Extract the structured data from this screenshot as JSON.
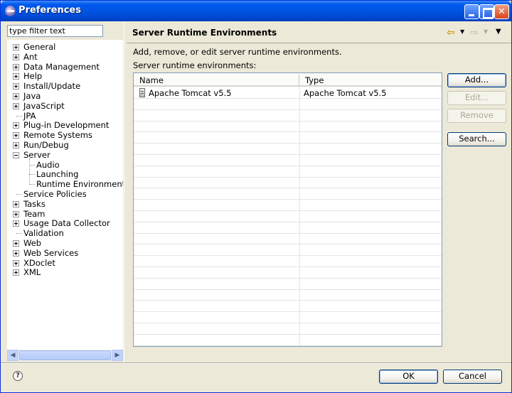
{
  "window": {
    "title": "Preferences"
  },
  "filter": {
    "value": "type filter text"
  },
  "tree": [
    {
      "label": "General",
      "expander": "plus",
      "level": 0
    },
    {
      "label": "Ant",
      "expander": "plus",
      "level": 0
    },
    {
      "label": "Data Management",
      "expander": "plus",
      "level": 0
    },
    {
      "label": "Help",
      "expander": "plus",
      "level": 0
    },
    {
      "label": "Install/Update",
      "expander": "plus",
      "level": 0
    },
    {
      "label": "Java",
      "expander": "plus",
      "level": 0
    },
    {
      "label": "JavaScript",
      "expander": "plus",
      "level": 0
    },
    {
      "label": "JPA",
      "expander": "none",
      "level": 0
    },
    {
      "label": "Plug-in Development",
      "expander": "plus",
      "level": 0
    },
    {
      "label": "Remote Systems",
      "expander": "plus",
      "level": 0
    },
    {
      "label": "Run/Debug",
      "expander": "plus",
      "level": 0
    },
    {
      "label": "Server",
      "expander": "minus",
      "level": 0
    },
    {
      "label": "Audio",
      "expander": "none",
      "level": 1
    },
    {
      "label": "Launching",
      "expander": "none",
      "level": 1
    },
    {
      "label": "Runtime Environments",
      "expander": "none",
      "level": 1,
      "selected": true
    },
    {
      "label": "Service Policies",
      "expander": "none",
      "level": 0
    },
    {
      "label": "Tasks",
      "expander": "plus",
      "level": 0
    },
    {
      "label": "Team",
      "expander": "plus",
      "level": 0
    },
    {
      "label": "Usage Data Collector",
      "expander": "plus",
      "level": 0
    },
    {
      "label": "Validation",
      "expander": "none",
      "level": 0
    },
    {
      "label": "Web",
      "expander": "plus",
      "level": 0
    },
    {
      "label": "Web Services",
      "expander": "plus",
      "level": 0
    },
    {
      "label": "XDoclet",
      "expander": "plus",
      "level": 0
    },
    {
      "label": "XML",
      "expander": "plus",
      "level": 0
    }
  ],
  "page": {
    "title": "Server Runtime Environments",
    "description": "Add, remove, or edit server runtime environments.",
    "table_label": "Server runtime environments:",
    "columns": [
      "Name",
      "Type"
    ],
    "rows": [
      {
        "name": "Apache Tomcat v5.5",
        "type": "Apache Tomcat v5.5",
        "icon": "server-icon"
      }
    ],
    "buttons": {
      "add": "Add...",
      "edit": "Edit...",
      "remove": "Remove",
      "search": "Search..."
    }
  },
  "footer": {
    "ok": "OK",
    "cancel": "Cancel",
    "help_glyph": "?"
  }
}
